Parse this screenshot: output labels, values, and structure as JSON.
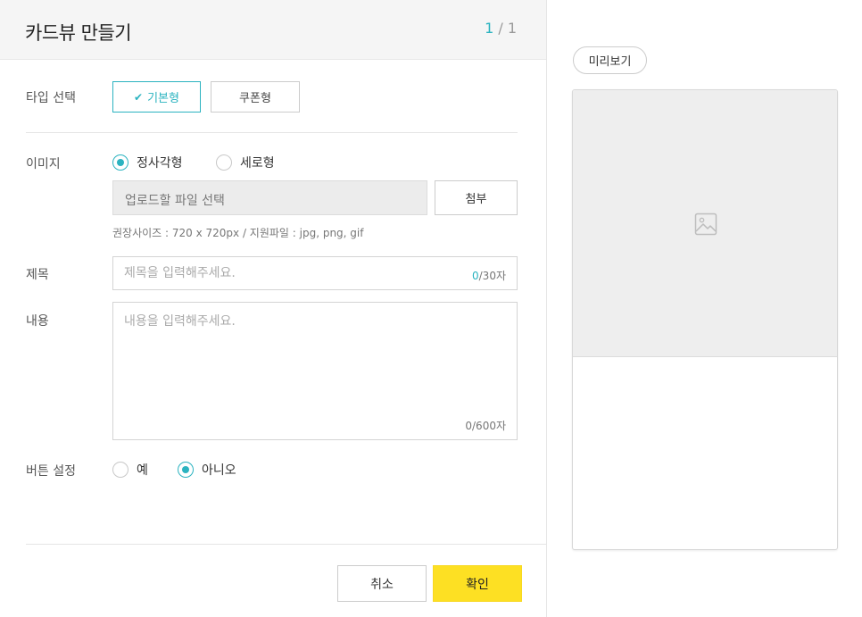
{
  "header": {
    "title": "카드뷰 만들기",
    "page_current": "1",
    "page_separator": " / ",
    "page_total": "1"
  },
  "type_select": {
    "label": "타입 선택",
    "options": [
      {
        "label": "기본형",
        "selected": true
      },
      {
        "label": "쿠폰형",
        "selected": false
      }
    ],
    "check_glyph": "✔"
  },
  "image": {
    "label": "이미지",
    "ratio_options": [
      {
        "label": "정사각형",
        "selected": true
      },
      {
        "label": "세로형",
        "selected": false
      }
    ],
    "file_placeholder": "업로드할 파일 선택",
    "attach_label": "첨부",
    "hint": "권장사이즈 : 720 x 720px / 지원파일 : jpg, png, gif"
  },
  "subject": {
    "label": "제목",
    "placeholder": "제목을 입력해주세요.",
    "count": "0",
    "max": "/30자"
  },
  "content": {
    "label": "내용",
    "placeholder": "내용을 입력해주세요.",
    "counter": "0/600자"
  },
  "button_setting": {
    "label": "버튼 설정",
    "options": [
      {
        "label": "예",
        "selected": false
      },
      {
        "label": "아니오",
        "selected": true
      }
    ]
  },
  "footer": {
    "cancel_label": "취소",
    "confirm_label": "확인"
  },
  "preview": {
    "label": "미리보기",
    "image_icon": "image-placeholder-icon"
  },
  "colors": {
    "accent": "#2bb3c0",
    "confirm_bg": "#fde023",
    "header_bg": "#f5f5f5",
    "preview_image_bg": "#eeeeee"
  }
}
